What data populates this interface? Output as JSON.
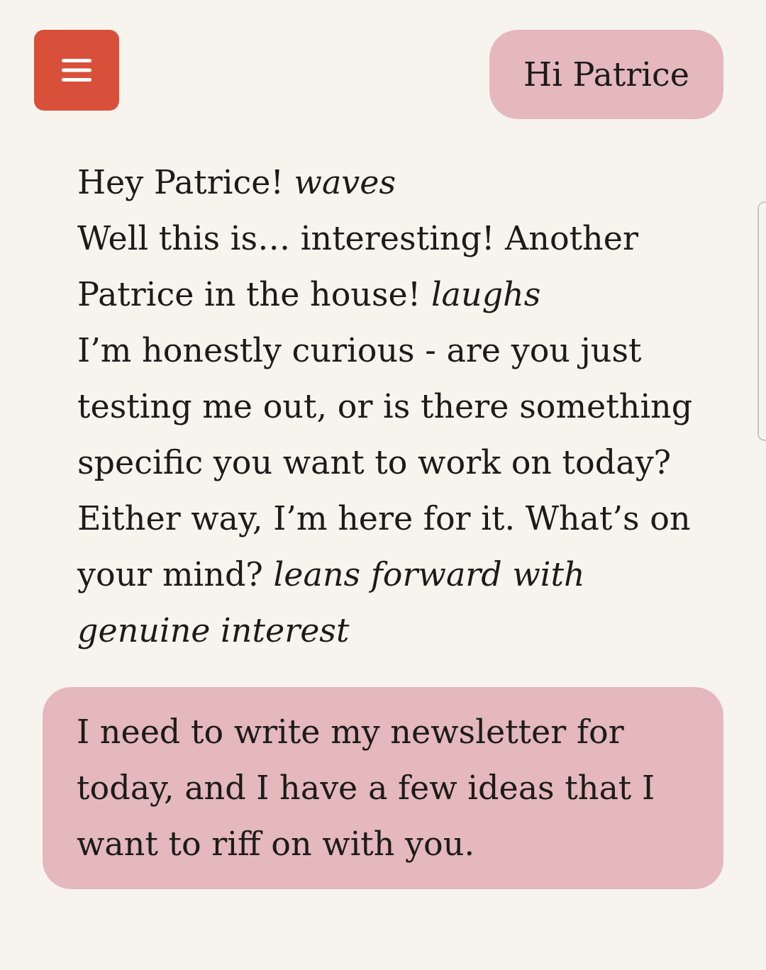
{
  "header": {
    "greeting": "Hi Patrice"
  },
  "messages": [
    {
      "kind": "assistant",
      "paragraphs": [
        "Hey Patrice! *waves*",
        "Well this is… interesting! Another Patrice in the house! *laughs*",
        "I’m honestly curious - are you just testing me out, or is there something specific you want to work on today? Either way, I’m here for it. What’s on your mind? *leans forward with genuine interest*"
      ]
    },
    {
      "kind": "user",
      "paragraphs": [
        "I need to write my newsletter for today, and I have a few ideas that I want to riff on with you."
      ]
    }
  ]
}
